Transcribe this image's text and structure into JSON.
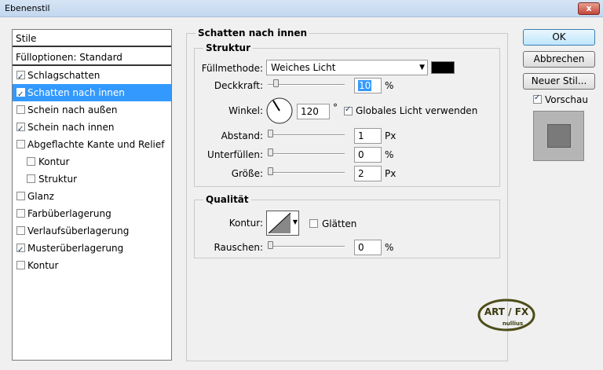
{
  "window": {
    "title": "Ebenenstil",
    "close_label": "x"
  },
  "stylelist": {
    "header": "Stile",
    "blend": "Fülloptionen: Standard",
    "items": [
      {
        "label": "Schlagschatten",
        "checked": true
      },
      {
        "label": "Schatten nach innen",
        "checked": true
      },
      {
        "label": "Schein nach außen",
        "checked": false
      },
      {
        "label": "Schein nach innen",
        "checked": true
      },
      {
        "label": "Abgeflachte Kante und Relief",
        "checked": false
      },
      {
        "label": "Kontur",
        "checked": false
      },
      {
        "label": "Struktur",
        "checked": false
      },
      {
        "label": "Glanz",
        "checked": false
      },
      {
        "label": "Farbüberlagerung",
        "checked": false
      },
      {
        "label": "Verlaufsüberlagerung",
        "checked": false
      },
      {
        "label": "Musterüberlagerung",
        "checked": true
      },
      {
        "label": "Kontur",
        "checked": false
      }
    ]
  },
  "panel": {
    "title": "Schatten nach innen",
    "structure": {
      "title": "Struktur",
      "blend_mode_label": "Füllmethode:",
      "blend_mode": "Weiches Licht",
      "color": "#000000",
      "opacity_label": "Deckkraft:",
      "opacity": "10",
      "opacity_unit": "%",
      "angle_label": "Winkel:",
      "angle": "120",
      "angle_unit": "°",
      "global_light_label": "Globales Licht verwenden",
      "global_light": true,
      "distance_label": "Abstand:",
      "distance": "1",
      "distance_unit": "Px",
      "choke_label": "Unterfüllen:",
      "choke": "0",
      "choke_unit": "%",
      "size_label": "Größe:",
      "size": "2",
      "size_unit": "Px"
    },
    "quality": {
      "title": "Qualität",
      "contour_label": "Kontur:",
      "antialias_label": "Glätten",
      "antialias": false,
      "noise_label": "Rauschen:",
      "noise": "0",
      "noise_unit": "%"
    }
  },
  "buttons": {
    "ok": "OK",
    "reset": "Abbrechen",
    "new_style": "Neuer Stil...",
    "preview_label": "Vorschau",
    "preview": true
  },
  "logo": {
    "line1": "ART / FX",
    "line2": "nullius"
  }
}
